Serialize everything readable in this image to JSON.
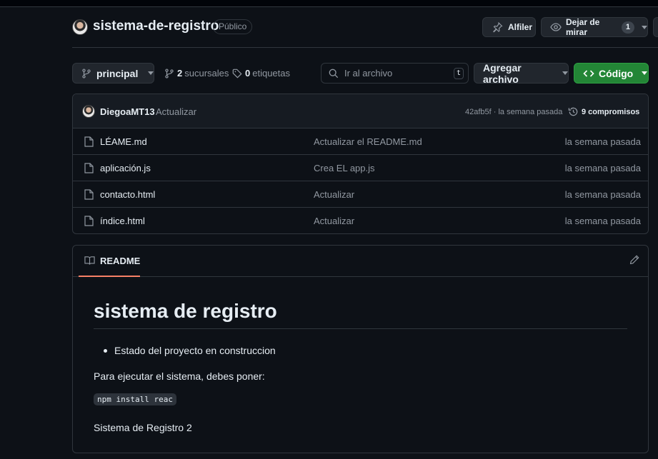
{
  "repo": {
    "name": "sistema-de-registro",
    "visibility": "Público",
    "pin_label": "Alfiler",
    "watch_label": "Dejar de mirar",
    "watch_count": "1"
  },
  "toolbar": {
    "branch_label": "principal",
    "branches_count": "2",
    "branches_label": "sucursales",
    "tags_count": "0",
    "tags_label": "etiquetas",
    "search_placeholder": "Ir al archivo",
    "search_shortcut": "t",
    "add_file_label": "Agregar archivo",
    "code_label": "Código"
  },
  "latest_commit": {
    "author": "DiegoaMT13",
    "message": "Actualizar",
    "sha_time": "42afb5f · la semana pasada",
    "commits_label": "9 compromisos"
  },
  "files": [
    {
      "name": "LÉAME.md",
      "message": "Actualizar el README.md",
      "date": "la semana pasada"
    },
    {
      "name": "aplicación.js",
      "message": "Crea EL app.js",
      "date": "la semana pasada"
    },
    {
      "name": "contacto.html",
      "message": "Actualizar",
      "date": "la semana pasada"
    },
    {
      "name": "índice.html",
      "message": "Actualizar",
      "date": "la semana pasada"
    }
  ],
  "readme": {
    "tab_label": "README",
    "title": "sistema de registro",
    "bullet": "Estado del proyecto en construccion",
    "para1": "Para ejecutar el sistema, debes poner:",
    "code": "npm install reac",
    "para2": "Sistema de Registro 2"
  },
  "colors": {
    "background": "#0d1117",
    "border": "#30363d",
    "primary_button": "#238636",
    "readme_tab_underline": "#f78166"
  }
}
